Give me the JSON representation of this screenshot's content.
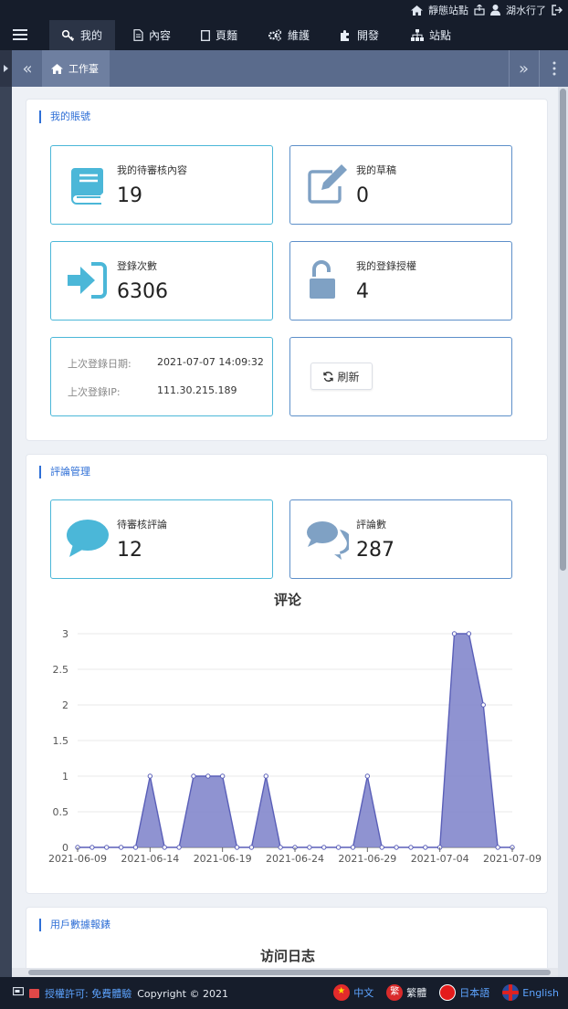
{
  "topbar": {
    "static_site": "靜態站點",
    "user": "湖水行了"
  },
  "nav": {
    "items": [
      {
        "label": "我的",
        "icon": "key-icon"
      },
      {
        "label": "內容",
        "icon": "document-icon"
      },
      {
        "label": "頁麵",
        "icon": "page-icon"
      },
      {
        "label": "維護",
        "icon": "cogs-icon"
      },
      {
        "label": "開發",
        "icon": "puzzle-icon"
      },
      {
        "label": "站點",
        "icon": "sitemap-icon"
      }
    ]
  },
  "tabs": {
    "workbench": "工作臺"
  },
  "account": {
    "title": "我的賬號",
    "pending_label": "我的待審核內容",
    "pending_value": "19",
    "draft_label": "我的草稿",
    "draft_value": "0",
    "login_count_label": "登錄次數",
    "login_count_value": "6306",
    "auth_label": "我的登錄授權",
    "auth_value": "4",
    "last_login_date_label": "上次登錄日期:",
    "last_login_date_value": "2021-07-07 14:09:32",
    "last_login_ip_label": "上次登錄IP:",
    "last_login_ip_value": "111.30.215.189",
    "refresh_label": "刷新"
  },
  "comments": {
    "title": "評論管理",
    "pending_label": "待審核評論",
    "pending_value": "12",
    "count_label": "評論數",
    "count_value": "287"
  },
  "chart_data": {
    "type": "area",
    "title": "评论",
    "xlabel": "",
    "ylabel": "",
    "ylim": [
      0,
      3
    ],
    "yticks": [
      "0",
      "0.5",
      "1",
      "1.5",
      "2",
      "2.5",
      "3"
    ],
    "xtick_labels": [
      "2021-06-09",
      "2021-06-14",
      "2021-06-19",
      "2021-06-24",
      "2021-06-29",
      "2021-07-04",
      "2021-07-09"
    ],
    "x": [
      "2021-06-09",
      "2021-06-10",
      "2021-06-11",
      "2021-06-12",
      "2021-06-13",
      "2021-06-14",
      "2021-06-15",
      "2021-06-16",
      "2021-06-17",
      "2021-06-18",
      "2021-06-19",
      "2021-06-20",
      "2021-06-21",
      "2021-06-22",
      "2021-06-23",
      "2021-06-24",
      "2021-06-25",
      "2021-06-26",
      "2021-06-27",
      "2021-06-28",
      "2021-06-29",
      "2021-06-30",
      "2021-07-01",
      "2021-07-02",
      "2021-07-03",
      "2021-07-04",
      "2021-07-05",
      "2021-07-06",
      "2021-07-07",
      "2021-07-08",
      "2021-07-09"
    ],
    "values": [
      0,
      0,
      0,
      0,
      0,
      1,
      0,
      0,
      1,
      1,
      1,
      0,
      0,
      1,
      0,
      0,
      0,
      0,
      0,
      0,
      1,
      0,
      0,
      0,
      0,
      0,
      3,
      3,
      2,
      0,
      0
    ],
    "grid": true,
    "color": "#7b80c9"
  },
  "user_stats": {
    "title": "用戶數據報錶",
    "chart_title": "访问日志"
  },
  "footer": {
    "license_label": "授權許可: 免費體驗",
    "copyright": "Copyright © 2021",
    "lang_zh": "中文",
    "lang_tw": "繁體",
    "lang_tw_flag_text": "繁",
    "lang_ja": "日本語",
    "lang_en": "English"
  }
}
